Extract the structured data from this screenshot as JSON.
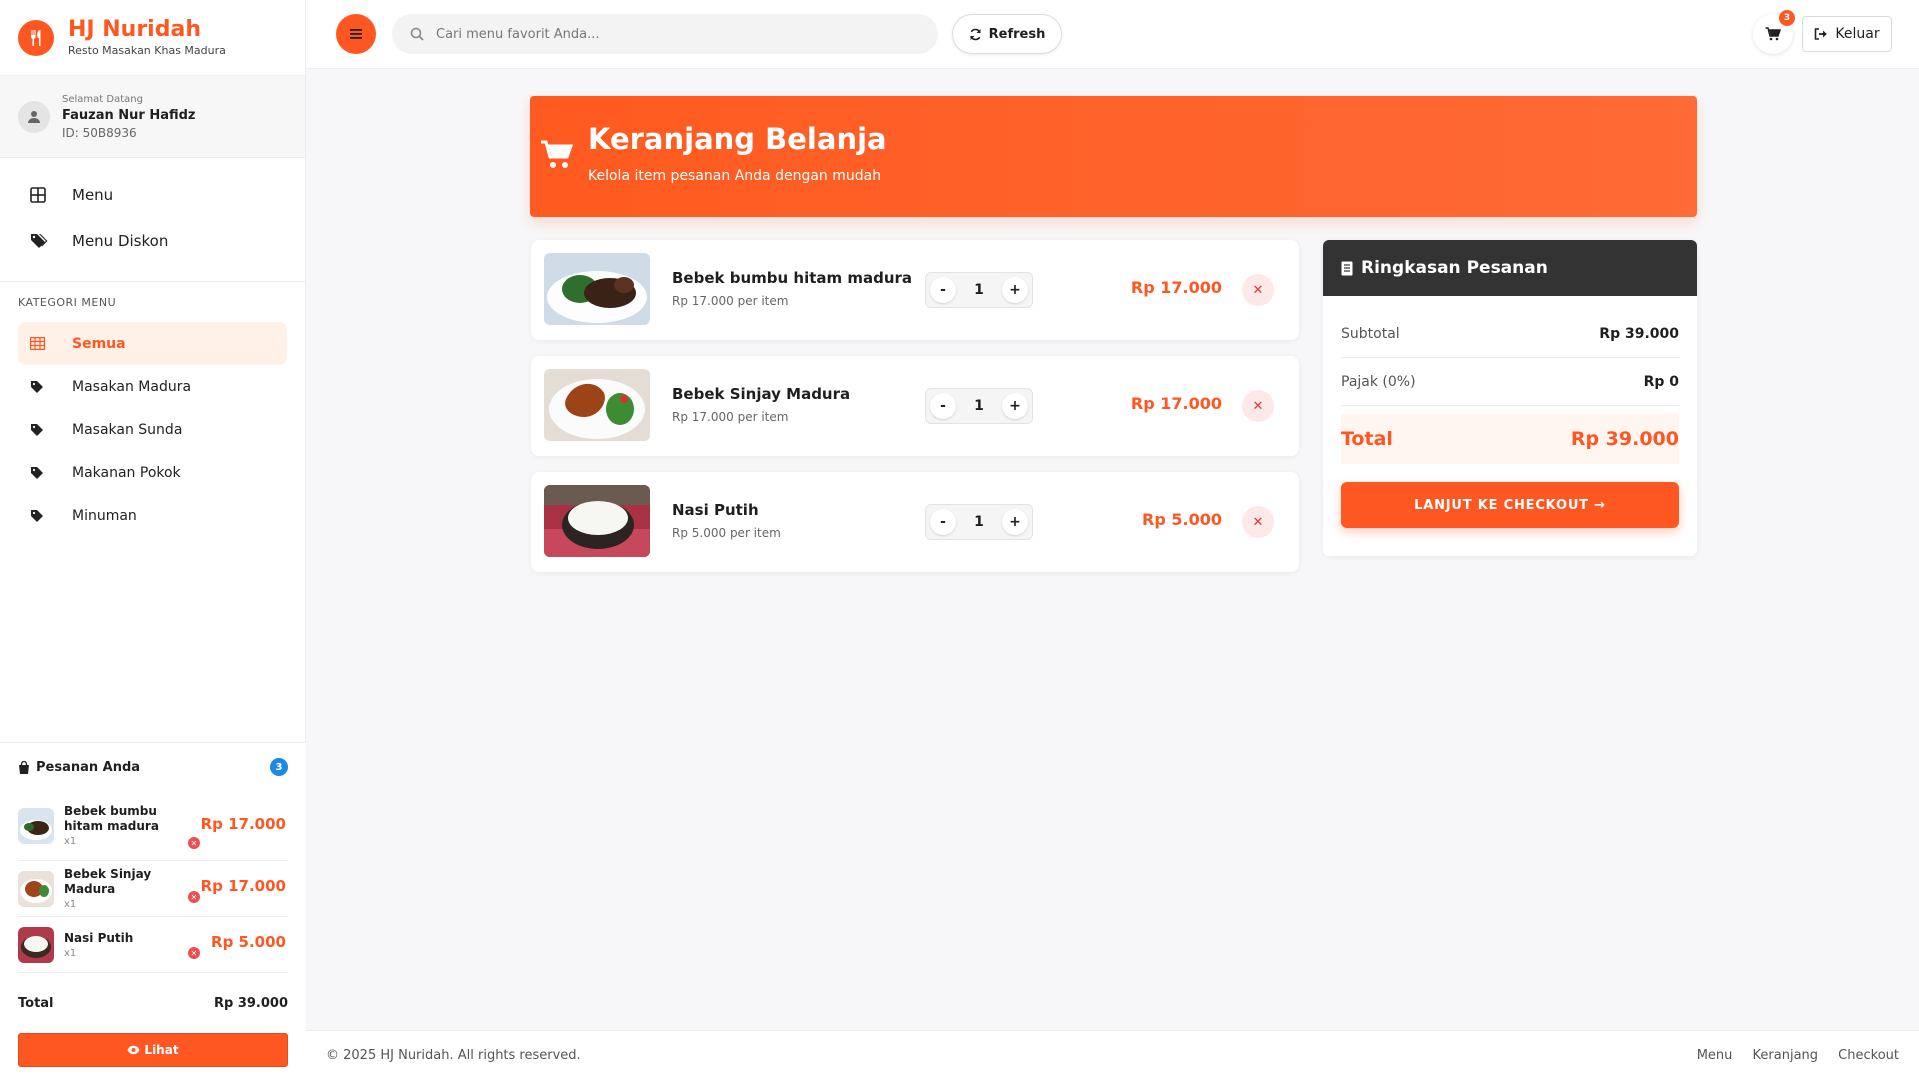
{
  "brand": {
    "name": "HJ Nuridah",
    "tagline": "Resto Masakan Khas Madura"
  },
  "user": {
    "greeting": "Selamat Datang",
    "name": "Fauzan Nur Hafidz",
    "id": "ID: 50B8936"
  },
  "nav": [
    {
      "label": "Menu",
      "icon": "grid-icon"
    },
    {
      "label": "Menu Diskon",
      "icon": "tags-icon"
    }
  ],
  "categories": {
    "title": "KATEGORI MENU",
    "items": [
      {
        "label": "Semua",
        "active": true
      },
      {
        "label": "Masakan Madura"
      },
      {
        "label": "Masakan Sunda"
      },
      {
        "label": "Makanan Pokok"
      },
      {
        "label": "Minuman"
      }
    ]
  },
  "orders_panel": {
    "title": "Pesanan Anda",
    "count": "3",
    "items": [
      {
        "name": "Bebek bumbu hitam madura",
        "qty": "x1",
        "price": "Rp 17.000"
      },
      {
        "name": "Bebek Sinjay Madura",
        "qty": "x1",
        "price": "Rp 17.000"
      },
      {
        "name": "Nasi Putih",
        "qty": "x1",
        "price": "Rp 5.000"
      }
    ],
    "total_label": "Total",
    "total_value": "Rp 39.000",
    "view_button": "Lihat"
  },
  "topbar": {
    "search_placeholder": "Cari menu favorit Anda...",
    "refresh_label": "Refresh",
    "cart_count": "3",
    "logout_label": "Keluar"
  },
  "hero": {
    "title": "Keranjang Belanja",
    "subtitle": "Kelola item pesanan Anda dengan mudah"
  },
  "cart_items": [
    {
      "name": "Bebek bumbu hitam madura",
      "unit_price": "Rp 17.000 per item",
      "qty": "1",
      "total": "Rp 17.000"
    },
    {
      "name": "Bebek Sinjay Madura",
      "unit_price": "Rp 17.000 per item",
      "qty": "1",
      "total": "Rp 17.000"
    },
    {
      "name": "Nasi Putih",
      "unit_price": "Rp 5.000 per item",
      "qty": "1",
      "total": "Rp 5.000"
    }
  ],
  "summary": {
    "title": "Ringkasan Pesanan",
    "subtotal_label": "Subtotal",
    "subtotal_value": "Rp 39.000",
    "tax_label": "Pajak (0%)",
    "tax_value": "Rp 0",
    "total_label": "Total",
    "total_value": "Rp 39.000",
    "checkout_label": "LANJUT KE CHECKOUT →"
  },
  "footer": {
    "copyright": "© 2025 HJ Nuridah. All rights reserved.",
    "links": [
      "Menu",
      "Keranjang",
      "Checkout"
    ]
  },
  "colors": {
    "accent": "#ff5722",
    "dark": "#333333",
    "danger": "#e53935",
    "info": "#1e88e5"
  }
}
